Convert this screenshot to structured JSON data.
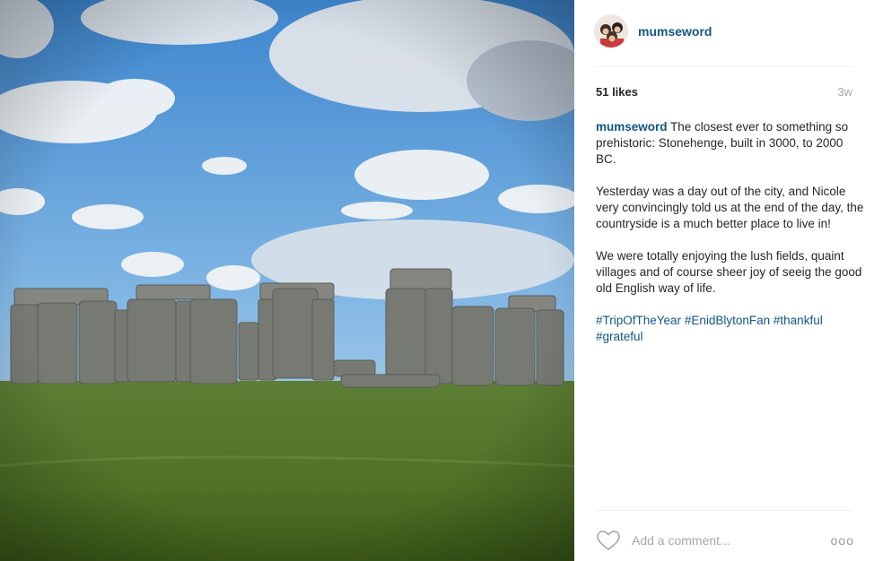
{
  "photo": {
    "subject": "stonehenge-photo",
    "colors": {
      "sky": "#5f9fd6",
      "grass": "#5a7d2c",
      "stone": "#7d7f78"
    }
  },
  "post": {
    "username": "mumseword",
    "likes": "51 likes",
    "time_ago": "3w",
    "caption": {
      "username": "mumseword",
      "paragraph1": " The closest ever to something so prehistoric: Stonehenge, built in 3000, to 2000 BC.",
      "paragraph2": "Yesterday was a day out of the city, and Nicole very convincingly told us at the end of the day, the countryside is a much better place to live in!",
      "paragraph3": "We were totally enjoying the lush fields, quaint villages and of course sheer joy of seeig the good old English way of life.",
      "hashtags": [
        "#TripOfTheYear",
        "#EnidBlytonFan",
        "#thankful",
        "#grateful"
      ]
    }
  },
  "footer": {
    "comment_placeholder": "Add a comment...",
    "more_label": "ooo"
  },
  "colors": {
    "link": "#125688",
    "muted": "#a5a7aa",
    "divider": "#efefef"
  }
}
